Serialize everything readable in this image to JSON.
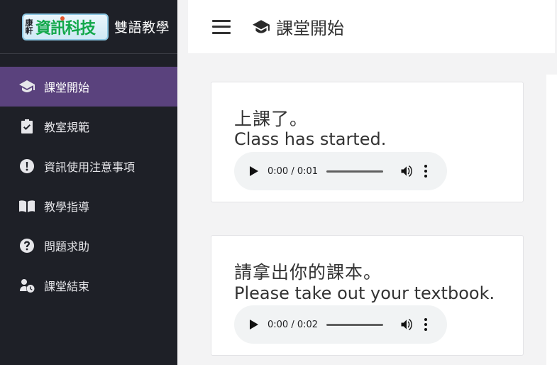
{
  "brand": {
    "logo_small": "康軒",
    "logo_main": "資訊科技",
    "title": "雙語教學"
  },
  "sidebar": {
    "items": [
      {
        "label": "課堂開始",
        "icon": "graduation-cap-icon",
        "active": true
      },
      {
        "label": "教室規範",
        "icon": "clipboard-check-icon",
        "active": false
      },
      {
        "label": "資訊使用注意事項",
        "icon": "exclamation-circle-icon",
        "active": false
      },
      {
        "label": "教學指導",
        "icon": "book-open-icon",
        "active": false
      },
      {
        "label": "問題求助",
        "icon": "question-circle-icon",
        "active": false
      },
      {
        "label": "課堂結束",
        "icon": "user-clock-icon",
        "active": false
      }
    ]
  },
  "header": {
    "title": "課堂開始",
    "title_icon": "graduation-cap-icon",
    "menu_icon": "hamburger-menu-icon"
  },
  "cards": [
    {
      "zh": "上課了。",
      "en": "Class has started.",
      "audio_time": "0:00 / 0:01"
    },
    {
      "zh": "請拿出你的課本。",
      "en": "Please take out your textbook.",
      "audio_time": "0:00 / 0:02"
    }
  ],
  "colors": {
    "sidebar_bg": "#1e2027",
    "active_item_bg": "#5a427d",
    "content_bg": "#f3f3f4",
    "audio_player_bg": "#f1f3f4"
  }
}
